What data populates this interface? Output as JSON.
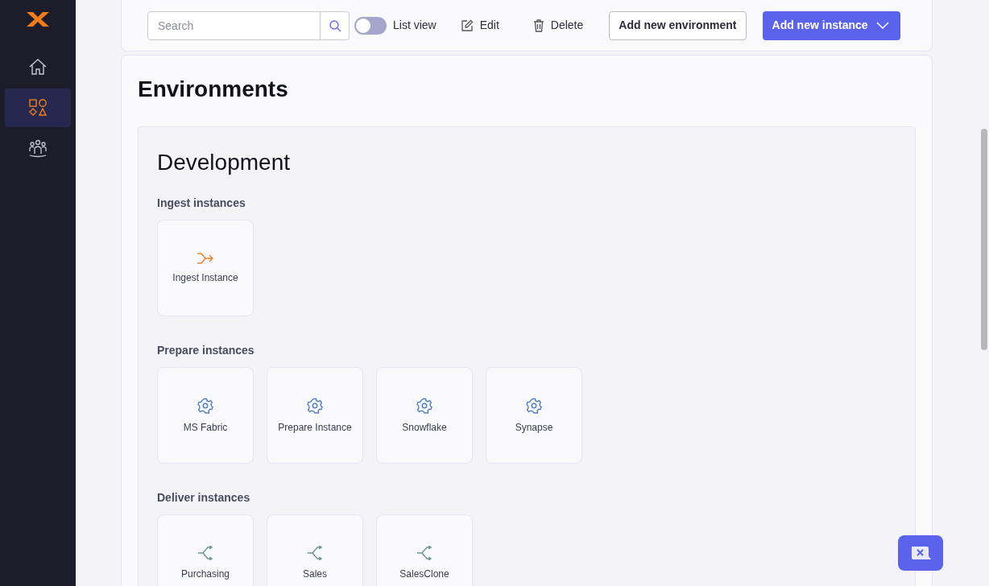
{
  "sidebar": {
    "items": [
      {
        "kind": "home",
        "selected": false
      },
      {
        "kind": "shapes",
        "selected": true
      },
      {
        "kind": "people",
        "selected": false
      }
    ]
  },
  "toolbar": {
    "search": {
      "placeholder": "Search"
    },
    "list_view": {
      "label": "List view",
      "on": false
    },
    "edit": "Edit",
    "delete": "Delete",
    "add_environment": "Add new environment",
    "add_instance": "Add new instance"
  },
  "page_title": "Environments",
  "environment": {
    "name": "Development",
    "sections": [
      {
        "title": "Ingest instances",
        "kind": "ingest",
        "instances": [
          "Ingest Instance"
        ]
      },
      {
        "title": "Prepare instances",
        "kind": "prepare",
        "instances": [
          "MS Fabric",
          "Prepare Instance",
          "Snowflake",
          "Synapse"
        ]
      },
      {
        "title": "Deliver instances",
        "kind": "deliver",
        "instances": [
          "Purchasing",
          "Sales",
          "SalesClone"
        ]
      }
    ]
  }
}
